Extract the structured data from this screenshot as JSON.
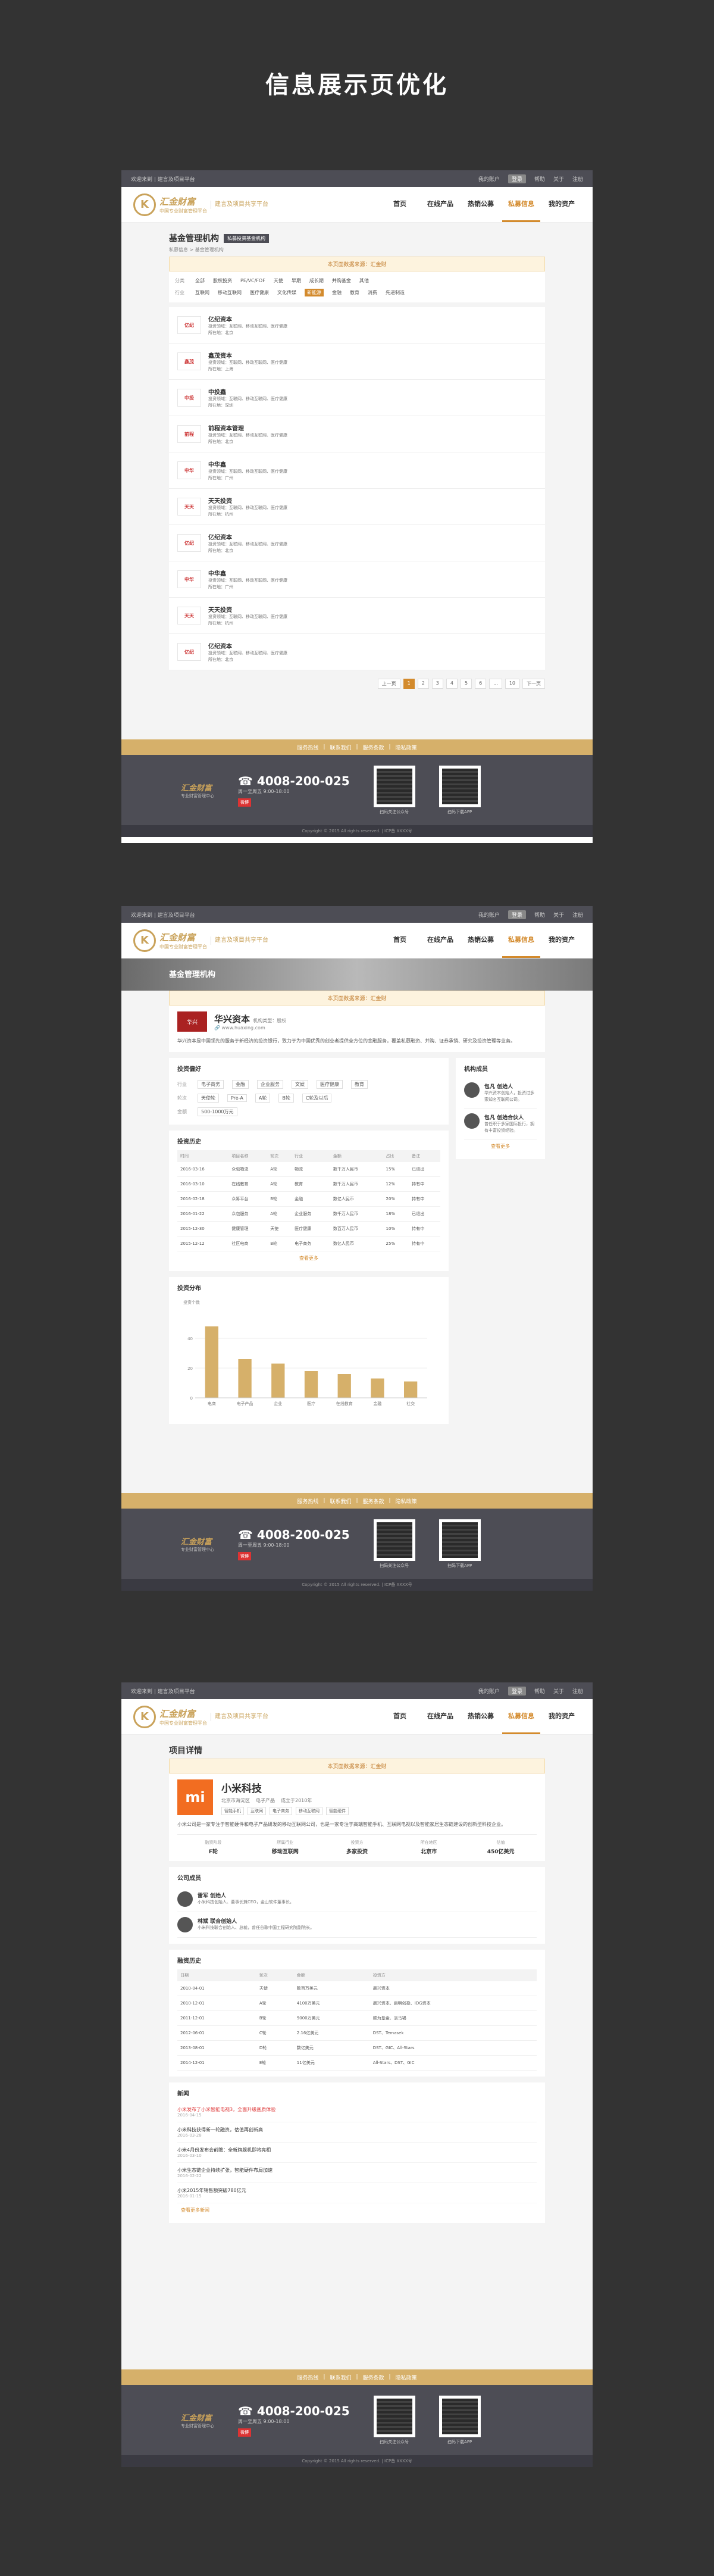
{
  "banner_title": "信息展示页优化",
  "common": {
    "topbar_left": "欢迎来到 | 建言及项目平台",
    "topbar_right": [
      "我的账户",
      "消息中心"
    ],
    "topbar_pill": "登录",
    "topbar_links": [
      "帮助",
      "关于",
      "注册"
    ],
    "logo_mark": "K",
    "logo_brand": "汇金财富",
    "logo_sub": "中国专业财富管理平台",
    "logo_slogan": "建言及项目共享平台",
    "nav": [
      "首页",
      "在线产品",
      "热销公募",
      "私募信息",
      "我的资产"
    ],
    "nav_active_index": 3,
    "footer_links": [
      "服务热线",
      "|",
      "联系我们",
      "|",
      "服务条款",
      "|",
      "隐私政策"
    ],
    "footer_logo": "汇金财富",
    "footer_sub": "专业财富管理中心",
    "footer_phone": "4008-200-025",
    "footer_hours": "周一至周五 9:00-18:00",
    "footer_weibo": "微博",
    "qr_labels": [
      "扫码关注公众号",
      "扫码下载APP"
    ],
    "copyright": "Copyright © 2015 All rights reserved. | ICP备 XXXX号"
  },
  "page1": {
    "title": "基金管理机构",
    "tag": "私募投资基金机构",
    "crumb": "私募信息 > 基金管理机构",
    "notice": "本页面数据来源：汇金财",
    "filter_rows": [
      {
        "label": "分类",
        "chips": [
          "全部",
          "股权投资",
          "PE/VC/FOF",
          "天使",
          "早期",
          "成长期",
          "并购基金",
          "其他"
        ],
        "selected": -1
      },
      {
        "label": "行业",
        "chips": [
          "互联网",
          "移动互联网",
          "医疗健康",
          "文化传媒",
          "新能源",
          "金融",
          "教育",
          "消费",
          "先进制造"
        ],
        "selected": 4
      }
    ],
    "items": [
      {
        "name": "亿纪资本",
        "logo": "亿纪",
        "desc": "投资领域：互联网、移动互联网、医疗健康",
        "sub": "所在地：北京"
      },
      {
        "name": "鑫茂资本",
        "logo": "鑫茂",
        "desc": "投资领域：互联网、移动互联网、医疗健康",
        "sub": "所在地：上海"
      },
      {
        "name": "中投鑫",
        "logo": "中投",
        "desc": "投资领域：互联网、移动互联网、医疗健康",
        "sub": "所在地：深圳"
      },
      {
        "name": "前程资本管理",
        "logo": "前程",
        "desc": "投资领域：互联网、移动互联网、医疗健康",
        "sub": "所在地：北京"
      },
      {
        "name": "中华鑫",
        "logo": "中华",
        "desc": "投资领域：互联网、移动互联网、医疗健康",
        "sub": "所在地：广州"
      },
      {
        "name": "天天投资",
        "logo": "天天",
        "desc": "投资领域：互联网、移动互联网、医疗健康",
        "sub": "所在地：杭州"
      },
      {
        "name": "亿纪资本",
        "logo": "亿纪",
        "desc": "投资领域：互联网、移动互联网、医疗健康",
        "sub": "所在地：北京"
      },
      {
        "name": "中华鑫",
        "logo": "中华",
        "desc": "投资领域：互联网、移动互联网、医疗健康",
        "sub": "所在地：广州"
      },
      {
        "name": "天天投资",
        "logo": "天天",
        "desc": "投资领域：互联网、移动互联网、医疗健康",
        "sub": "所在地：杭州"
      },
      {
        "name": "亿纪资本",
        "logo": "亿纪",
        "desc": "投资领域：互联网、移动互联网、医疗健康",
        "sub": "所在地：北京"
      }
    ],
    "pager": [
      "上一页",
      "1",
      "2",
      "3",
      "4",
      "5",
      "6",
      "...",
      "10",
      "下一页"
    ],
    "pager_current": 1
  },
  "page2": {
    "hero": "基金管理机构",
    "notice": "本页面数据来源：汇金财",
    "org_name": "华兴资本",
    "org_tag": "机构类型：股权",
    "org_logo": "华兴",
    "org_site": "www.huaxing.com",
    "org_intro": "华兴资本是中国领先的服务于新经济的投资银行，致力于为中国优秀的创业者提供全方位的金融服务，覆盖私募融资、并购、证券承销、研究及投资管理等业务。",
    "pref_title": "投资偏好",
    "pref_rows": [
      {
        "label": "行业",
        "vals": [
          "电子商务",
          "金融",
          "企业服务",
          "文娱",
          "医疗健康",
          "教育"
        ]
      },
      {
        "label": "轮次",
        "vals": [
          "天使轮",
          "Pre-A",
          "A轮",
          "B轮",
          "C轮及以后"
        ]
      },
      {
        "label": "金额",
        "vals": [
          "500-1000万元"
        ]
      }
    ],
    "history_title": "投资历史",
    "history_headers": [
      "时间",
      "项目名称",
      "轮次",
      "行业",
      "金额",
      "占比",
      "备注"
    ],
    "history_rows": [
      [
        "2016-03-16",
        "众包物流",
        "A轮",
        "物流",
        "数千万人民币",
        "15%",
        "已退出"
      ],
      [
        "2016-03-10",
        "在线教育",
        "A轮",
        "教育",
        "数千万人民币",
        "12%",
        "持有中"
      ],
      [
        "2016-02-18",
        "众筹平台",
        "B轮",
        "金融",
        "数亿人民币",
        "20%",
        "持有中"
      ],
      [
        "2016-01-22",
        "众包服务",
        "A轮",
        "企业服务",
        "数千万人民币",
        "18%",
        "已退出"
      ],
      [
        "2015-12-30",
        "健康管理",
        "天使",
        "医疗健康",
        "数百万人民币",
        "10%",
        "持有中"
      ],
      [
        "2015-12-12",
        "社区电商",
        "B轮",
        "电子商务",
        "数亿人民币",
        "25%",
        "持有中"
      ]
    ],
    "more": "查看更多",
    "members_title": "机构成员",
    "members": [
      {
        "name": "包凡",
        "role": "创始人",
        "desc": "华兴资本创始人，投资过多家知名互联网公司。"
      },
      {
        "name": "包凡",
        "role": "创始合伙人",
        "desc": "曾任职于多家国际投行，拥有丰富投资经验。"
      }
    ],
    "dist_title": "投资分布"
  },
  "chart_data": {
    "type": "bar",
    "title": "投资分布",
    "ylabel": "投资个数",
    "categories": [
      "电商",
      "电子产品",
      "企业",
      "医疗",
      "在线教育",
      "金融",
      "社交"
    ],
    "values": [
      48,
      26,
      23,
      18,
      16,
      13,
      11
    ],
    "ylim": [
      0,
      60
    ],
    "yticks": [
      0,
      20,
      40
    ],
    "color": "#d6b06a"
  },
  "page3": {
    "title": "项目详情",
    "notice": "本页面数据来源：汇金财",
    "name": "小米科技",
    "logo": "mi",
    "meta": [
      "北京市海淀区",
      "电子产品",
      "成立于2010年"
    ],
    "tags": [
      "智能手机",
      "互联网",
      "电子商务",
      "移动互联网",
      "智能硬件"
    ],
    "intro": "小米公司是一家专注于智能硬件和电子产品研发的移动互联网公司，也是一家专注于高端智能手机、互联网电视以及智能家居生态链建设的创新型科技企业。",
    "stats": [
      {
        "k": "融资阶段",
        "v": "F轮"
      },
      {
        "k": "所属行业",
        "v": "移动互联网"
      },
      {
        "k": "投资方",
        "v": "多家投资"
      },
      {
        "k": "所在地区",
        "v": "北京市"
      },
      {
        "k": "估值",
        "v": "450亿美元"
      }
    ],
    "team_title": "公司成员",
    "team": [
      {
        "name": "雷军",
        "role": "创始人",
        "desc": "小米科技创始人、董事长兼CEO，金山软件董事长。"
      },
      {
        "name": "林斌",
        "role": "联合创始人",
        "desc": "小米科技联合创始人、总裁，曾任谷歌中国工程研究院副院长。"
      }
    ],
    "fund_title": "融资历史",
    "fund_headers": [
      "日期",
      "轮次",
      "金额",
      "投资方"
    ],
    "fund_rows": [
      [
        "2010-04-01",
        "天使",
        "数百万美元",
        "晨兴资本"
      ],
      [
        "2010-12-01",
        "A轮",
        "4100万美元",
        "晨兴资本、启明创投、IDG资本"
      ],
      [
        "2011-12-01",
        "B轮",
        "9000万美元",
        "顺为基金、淡马锡"
      ],
      [
        "2012-06-01",
        "C轮",
        "2.16亿美元",
        "DST、Temasek"
      ],
      [
        "2013-08-01",
        "D轮",
        "数亿美元",
        "DST、GIC、All-Stars"
      ],
      [
        "2014-12-01",
        "E轮",
        "11亿美元",
        "All-Stars、DST、GIC"
      ]
    ],
    "news_title": "新闻",
    "news": [
      {
        "t": "小米发布了小米智能电视3，全面升级画质体验",
        "d": "2016-04-15"
      },
      {
        "t": "小米科技获得新一轮融资，估值再创新高",
        "d": "2016-03-28"
      },
      {
        "t": "小米4月份发布会前瞻：全新旗舰机即将亮相",
        "d": "2016-03-10"
      },
      {
        "t": "小米生态链企业持续扩张，智能硬件布局加速",
        "d": "2016-02-22"
      },
      {
        "t": "小米2015年销售额突破780亿元",
        "d": "2016-01-15"
      }
    ],
    "news_more": "查看更多新闻"
  }
}
